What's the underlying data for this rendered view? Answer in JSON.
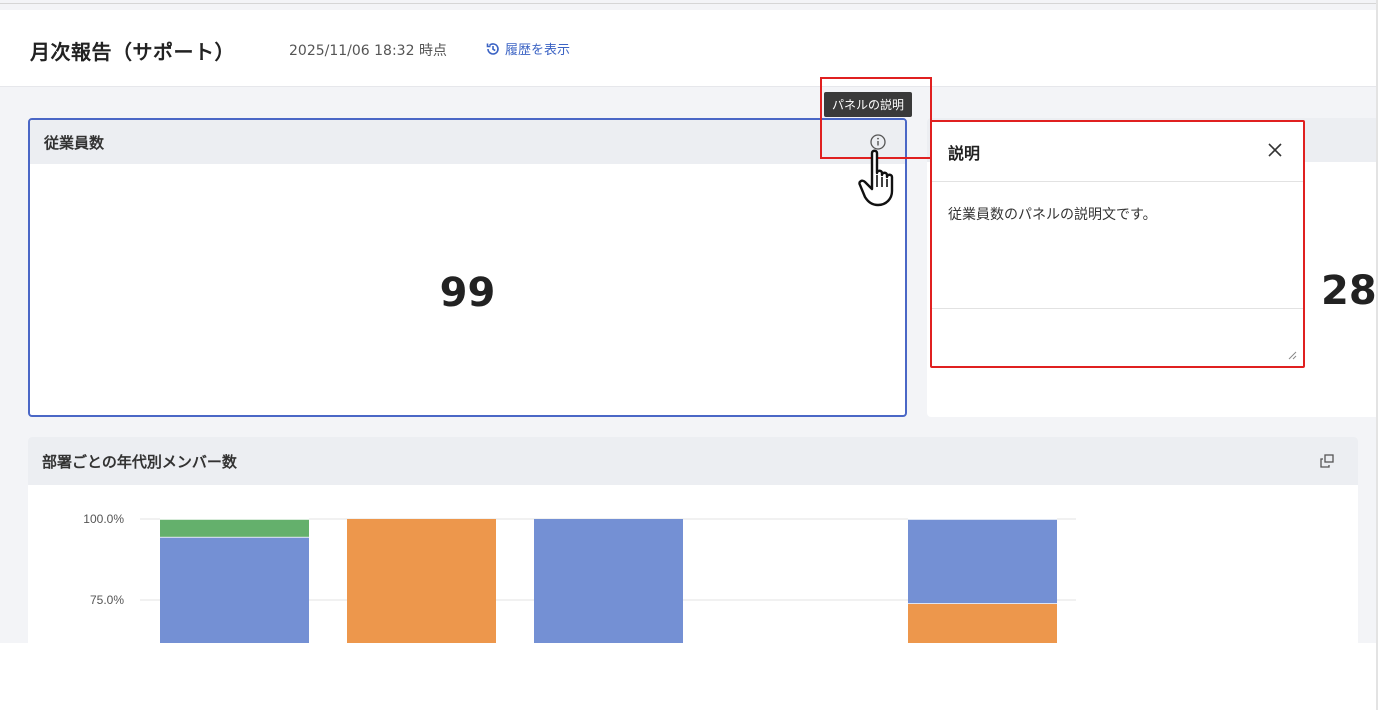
{
  "header": {
    "title": "月次報告（サポート）",
    "timestamp": "2025/11/06 18:32 時点",
    "history_link": "履歴を表示"
  },
  "panels": {
    "employees": {
      "title": "従業員数",
      "value": "99"
    },
    "second": {
      "title": "",
      "value": "28"
    },
    "dept_chart": {
      "title": "部署ごとの年代別メンバー数"
    }
  },
  "tooltip": {
    "text": "パネルの説明"
  },
  "description_popup": {
    "title": "説明",
    "body": "従業員数のパネルの説明文です。"
  },
  "icons": {
    "info": "info-icon",
    "close": "close-icon",
    "history": "history-icon",
    "popout": "popout-icon",
    "cursor": "hand-pointer-icon",
    "resize": "resize-handle-icon"
  },
  "colors": {
    "blue": "#7490d4",
    "orange": "#ed974c",
    "green": "#64b06c",
    "accent": "#3b63c4",
    "highlight": "#e02020"
  },
  "chart_data": {
    "type": "bar",
    "stacked": true,
    "percent": true,
    "y_ticks": [
      "100.0%",
      "75.0%"
    ],
    "ylim": [
      0,
      100
    ],
    "bars": [
      {
        "segments": [
          {
            "color": "#7490d4",
            "value": 94.5
          },
          {
            "color": "#64b06c",
            "value": 5.5
          }
        ]
      },
      {
        "segments": [
          {
            "color": "#ed974c",
            "value": 100
          }
        ]
      },
      {
        "segments": [
          {
            "color": "#7490d4",
            "value": 100
          }
        ]
      },
      {
        "segments": []
      },
      {
        "segments": [
          {
            "color": "#ed974c",
            "value": 74
          },
          {
            "color": "#7490d4",
            "value": 26
          }
        ]
      }
    ]
  }
}
